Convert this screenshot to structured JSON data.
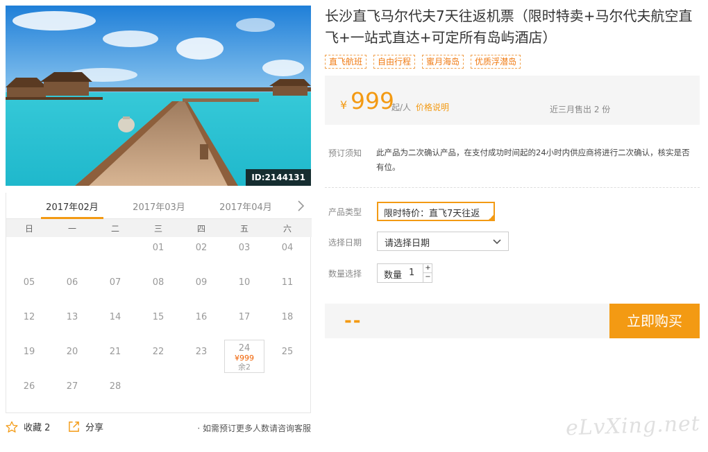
{
  "product": {
    "title": "长沙直飞马尔代夫7天往返机票（限时特卖+马尔代夫航空直飞+一站式直达+可定所有岛屿酒店）",
    "image_id": "ID:2144131",
    "tags": [
      "直飞航班",
      "自由行程",
      "蜜月海岛",
      "优质浮潜岛"
    ]
  },
  "price": {
    "currency": "¥",
    "amount": "999",
    "unit": "起/人",
    "price_note_link": "价格说明",
    "sold": "近三月售出 2 份"
  },
  "notice": {
    "label": "预订须知",
    "text": "此产品为二次确认产品，在支付成功时间起的24小时内供应商将进行二次确认，核实是否有位。"
  },
  "options": {
    "product_type_label": "产品类型",
    "product_type_value": "限时特价：直飞7天往返",
    "date_label": "选择日期",
    "date_value": "请选择日期",
    "qty_row_label": "数量选择",
    "qty_label": "数量",
    "qty_value": "1",
    "plus": "+",
    "minus": "−"
  },
  "buy": {
    "total": "--",
    "button": "立即购买"
  },
  "calendar": {
    "months": [
      "2017年02月",
      "2017年03月",
      "2017年04月"
    ],
    "active_month": "2017年02月",
    "weekdays": [
      "日",
      "一",
      "二",
      "三",
      "四",
      "五",
      "六"
    ],
    "rows": [
      [
        "",
        "",
        "",
        "01",
        "02",
        "03",
        "04"
      ],
      [
        "05",
        "06",
        "07",
        "08",
        "09",
        "10",
        "11"
      ],
      [
        "12",
        "13",
        "14",
        "15",
        "16",
        "17",
        "18"
      ],
      [
        "19",
        "20",
        "21",
        "22",
        "23",
        "24",
        "25"
      ],
      [
        "26",
        "27",
        "28",
        "",
        "",
        "",
        ""
      ]
    ],
    "available_day": {
      "day": "24",
      "price": "¥999",
      "remaining": "余2"
    }
  },
  "actions": {
    "favorite": "收藏 2",
    "share": "分享",
    "consult": "· 如需预订更多人数请咨询客服"
  },
  "watermark": "eLvXing.net",
  "colors": {
    "accent": "#f39a13",
    "link": "#f39a13",
    "sea": "#2cc3d6"
  }
}
